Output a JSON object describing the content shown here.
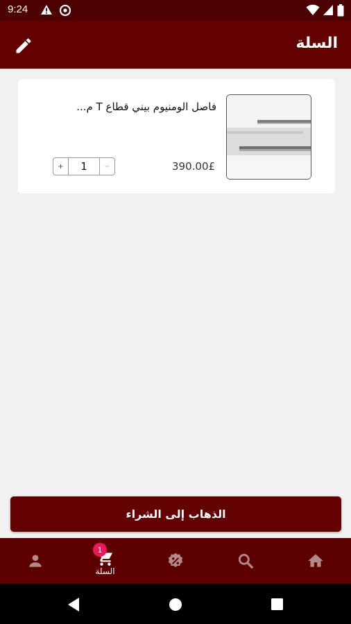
{
  "status_bar": {
    "time": "9:24",
    "icons": [
      "warning-icon",
      "data-saver-icon",
      "wifi-icon",
      "signal-icon",
      "battery-icon"
    ]
  },
  "app_bar": {
    "title": "السلة",
    "edit_icon": "pencil-icon"
  },
  "cart": {
    "items": [
      {
        "name": "فاصل الومنيوم بيني قطاع T م...",
        "price": "390.00£",
        "quantity": "1",
        "plus_label": "+",
        "minus_label": "−"
      }
    ]
  },
  "checkout": {
    "label": "الذهاب إلى الشراء"
  },
  "bottom_nav": {
    "items": [
      {
        "id": "account",
        "icon": "person-icon",
        "label": ""
      },
      {
        "id": "cart",
        "icon": "cart-icon",
        "label": "السلة",
        "badge": "1",
        "active": true
      },
      {
        "id": "offers",
        "icon": "discount-icon",
        "label": ""
      },
      {
        "id": "search",
        "icon": "search-icon",
        "label": ""
      },
      {
        "id": "home",
        "icon": "home-icon",
        "label": ""
      }
    ]
  },
  "system_nav": {
    "icons": [
      "back-icon",
      "home-circle-icon",
      "recents-icon"
    ]
  },
  "colors": {
    "primary": "#630000",
    "status_bar": "#4d0000",
    "nav_bar": "#5c0000",
    "inactive_nav_icon": "#b08a8a",
    "badge": "#e8185a",
    "background": "#f1f1f1"
  }
}
